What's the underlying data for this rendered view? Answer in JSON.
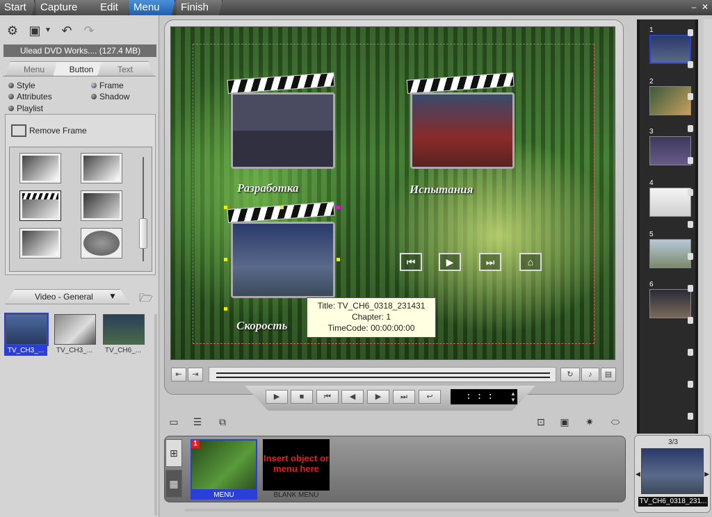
{
  "top_tabs": [
    "Start",
    "Capture",
    "Edit",
    "Menu",
    "Finish"
  ],
  "active_tab": "Menu",
  "window_controls": {
    "minimize": "–",
    "close": "✕"
  },
  "toolbar": {
    "icons": [
      "project-properties-icon",
      "save-icon",
      "dropdown-arrow-icon",
      "undo-icon",
      "redo-icon"
    ]
  },
  "project": {
    "name": "Ulead DVD Works.... (127.4 MB)"
  },
  "sub_tabs": [
    "Menu",
    "Button",
    "Text"
  ],
  "active_sub_tab": "Button",
  "button_options": {
    "style": "Style",
    "frame": "Frame",
    "attributes": "Attributes",
    "shadow": "Shadow",
    "playlist": "Playlist"
  },
  "frame_panel": {
    "remove_frame": "Remove Frame"
  },
  "library": {
    "category": "Video - General",
    "clips": [
      {
        "label": "TV_CH3_...",
        "selected": true
      },
      {
        "label": "TV_CH3_..."
      },
      {
        "label": "TV_CH6_..."
      }
    ]
  },
  "menu_canvas": {
    "buttons": [
      {
        "title": "Разработка"
      },
      {
        "title": "Испытания"
      },
      {
        "title": "Скорость"
      }
    ],
    "nav_buttons": [
      "prev-chapter",
      "play",
      "next-chapter",
      "home"
    ]
  },
  "tooltip": {
    "title": "Title: TV_CH6_0318_231431",
    "chapter": "Chapter: 1",
    "timecode": "TimeCode: 00:00:00:00"
  },
  "transport": {
    "timecode": ": : :"
  },
  "tray": {
    "items": [
      {
        "badge": "1",
        "label": "MENU"
      },
      {
        "text": "Insert object or menu here",
        "label": "BLANK MENU"
      }
    ]
  },
  "filmstrip": {
    "frames": [
      "1",
      "2",
      "3",
      "4",
      "5",
      "6"
    ]
  },
  "selected_preview": {
    "count": "3/3",
    "label": "TV_CH6_0318_231..."
  },
  "colors": {
    "accent": "#2a3fd9",
    "active_tab": "#2f76c9",
    "safe_area": "#e06060"
  }
}
